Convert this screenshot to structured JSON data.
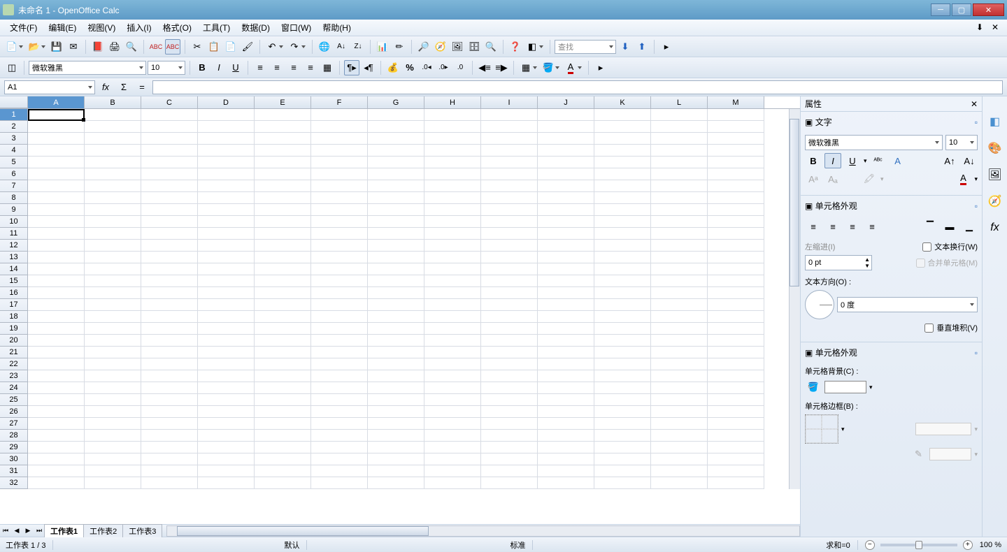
{
  "window": {
    "title": "未命名 1 - OpenOffice Calc"
  },
  "menu": {
    "file": "文件(F)",
    "edit": "编辑(E)",
    "view": "视图(V)",
    "insert": "插入(I)",
    "format": "格式(O)",
    "tools": "工具(T)",
    "data": "数据(D)",
    "window": "窗口(W)",
    "help": "帮助(H)"
  },
  "toolbar2": {
    "font_name": "微软雅黑",
    "font_size": "10"
  },
  "search": {
    "placeholder": "查找"
  },
  "formula": {
    "cell_ref": "A1",
    "value": ""
  },
  "sheet": {
    "columns": [
      "A",
      "B",
      "C",
      "D",
      "E",
      "F",
      "G",
      "H",
      "I",
      "J",
      "K",
      "L",
      "M"
    ],
    "rows": 32,
    "tabs": [
      "工作表1",
      "工作表2",
      "工作表3"
    ],
    "active_tab": 0
  },
  "properties": {
    "title": "属性",
    "text_section": "文字",
    "font_name": "微软雅黑",
    "font_size": "10",
    "cell_appearance": "单元格外观",
    "indent_label": "左缩进(I)",
    "indent_value": "0 pt",
    "wrap_label": "文本换行(W)",
    "merge_label": "合并单元格(M)",
    "text_dir_label": "文本方向(O) :",
    "angle_value": "0 度",
    "vertical_stack": "垂直堆积(V)",
    "cell_appearance2": "单元格外观",
    "cell_bg_label": "单元格背景(C) :",
    "cell_border_label": "单元格边框(B) :"
  },
  "status": {
    "sheet_pos": "工作表 1 / 3",
    "style": "默认",
    "mode": "标准",
    "sum": "求和=0",
    "zoom": "100 %"
  }
}
